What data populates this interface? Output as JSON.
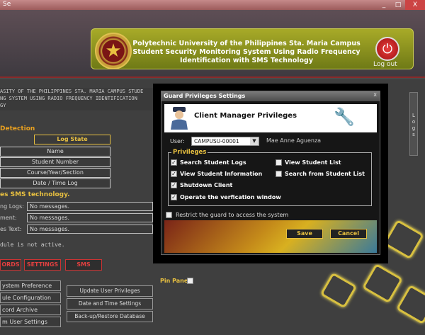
{
  "window": {
    "app_label": "Se",
    "controls": [
      "_",
      "□",
      "X"
    ]
  },
  "header": {
    "line1": "Polytechnic University of the Philippines Sta. Maria Campus",
    "line2": "Student Security Monitoring System Using Radio Frequency",
    "line3": "Identification with SMS Technology",
    "logout_label": "Log out"
  },
  "main": {
    "banner_lines": [
      "ASITY OF THE PHILIPPINES STA. MARIA CAMPUS STUDE",
      "NG SYSTEM USING RADIO FREQUENCY IDENTIFICATION",
      "GY"
    ],
    "detection_title": "Detection",
    "log_state": "Log State",
    "fields": [
      "Name",
      "Student Number",
      "Course/Year/Section",
      "Date / Time Log"
    ],
    "sms_title": "es SMS technology.",
    "sms_rows": [
      {
        "label": "ng Logs:",
        "value": "No messages."
      },
      {
        "label": "ment:",
        "value": "No messages."
      },
      {
        "label": "es Text:",
        "value": "No messages."
      }
    ],
    "module_status": "dule is not active.",
    "nav_tabs": [
      "ORDS",
      "SETTINGS",
      "SMS"
    ],
    "pin_panel": "Pin Panel",
    "settings_menu": [
      "ystem Preference",
      "ule Configuration",
      "cord Archive",
      "m User Settings"
    ],
    "actions": [
      "Update User Privileges",
      "Date and Time Settings",
      "Back-up/Restore Database"
    ],
    "right_tab": "L o g s"
  },
  "dialog": {
    "title": "Guard Privileges Settings",
    "close": "x",
    "heading": "Client Manager Privileges",
    "user_label": "User:",
    "user_value": "CAMPUSU-00001",
    "user_name": "Mae Anne Aguenza",
    "privileges_title": "Privileges",
    "privileges": [
      {
        "label": "Search Student Logs",
        "checked": true
      },
      {
        "label": "View Student Information",
        "checked": true
      },
      {
        "label": "Shutdown Client",
        "checked": true
      },
      {
        "label": "Operate the verfication window",
        "checked": true
      },
      {
        "label": "View Student List",
        "checked": false
      },
      {
        "label": "Search from Student List",
        "checked": false
      }
    ],
    "restrict_label": "Restrict the guard to access the system",
    "restrict_checked": false,
    "save_label": "Save",
    "cancel_label": "Cancel"
  },
  "colors": {
    "accent_gold": "#e8c040",
    "accent_red": "#e04040",
    "header_green": "#8a9a20"
  },
  "icons": [
    "seal-icon",
    "power-icon",
    "guard-icon",
    "tools-icon",
    "dropdown-arrow-icon",
    "checkbox-icon"
  ]
}
